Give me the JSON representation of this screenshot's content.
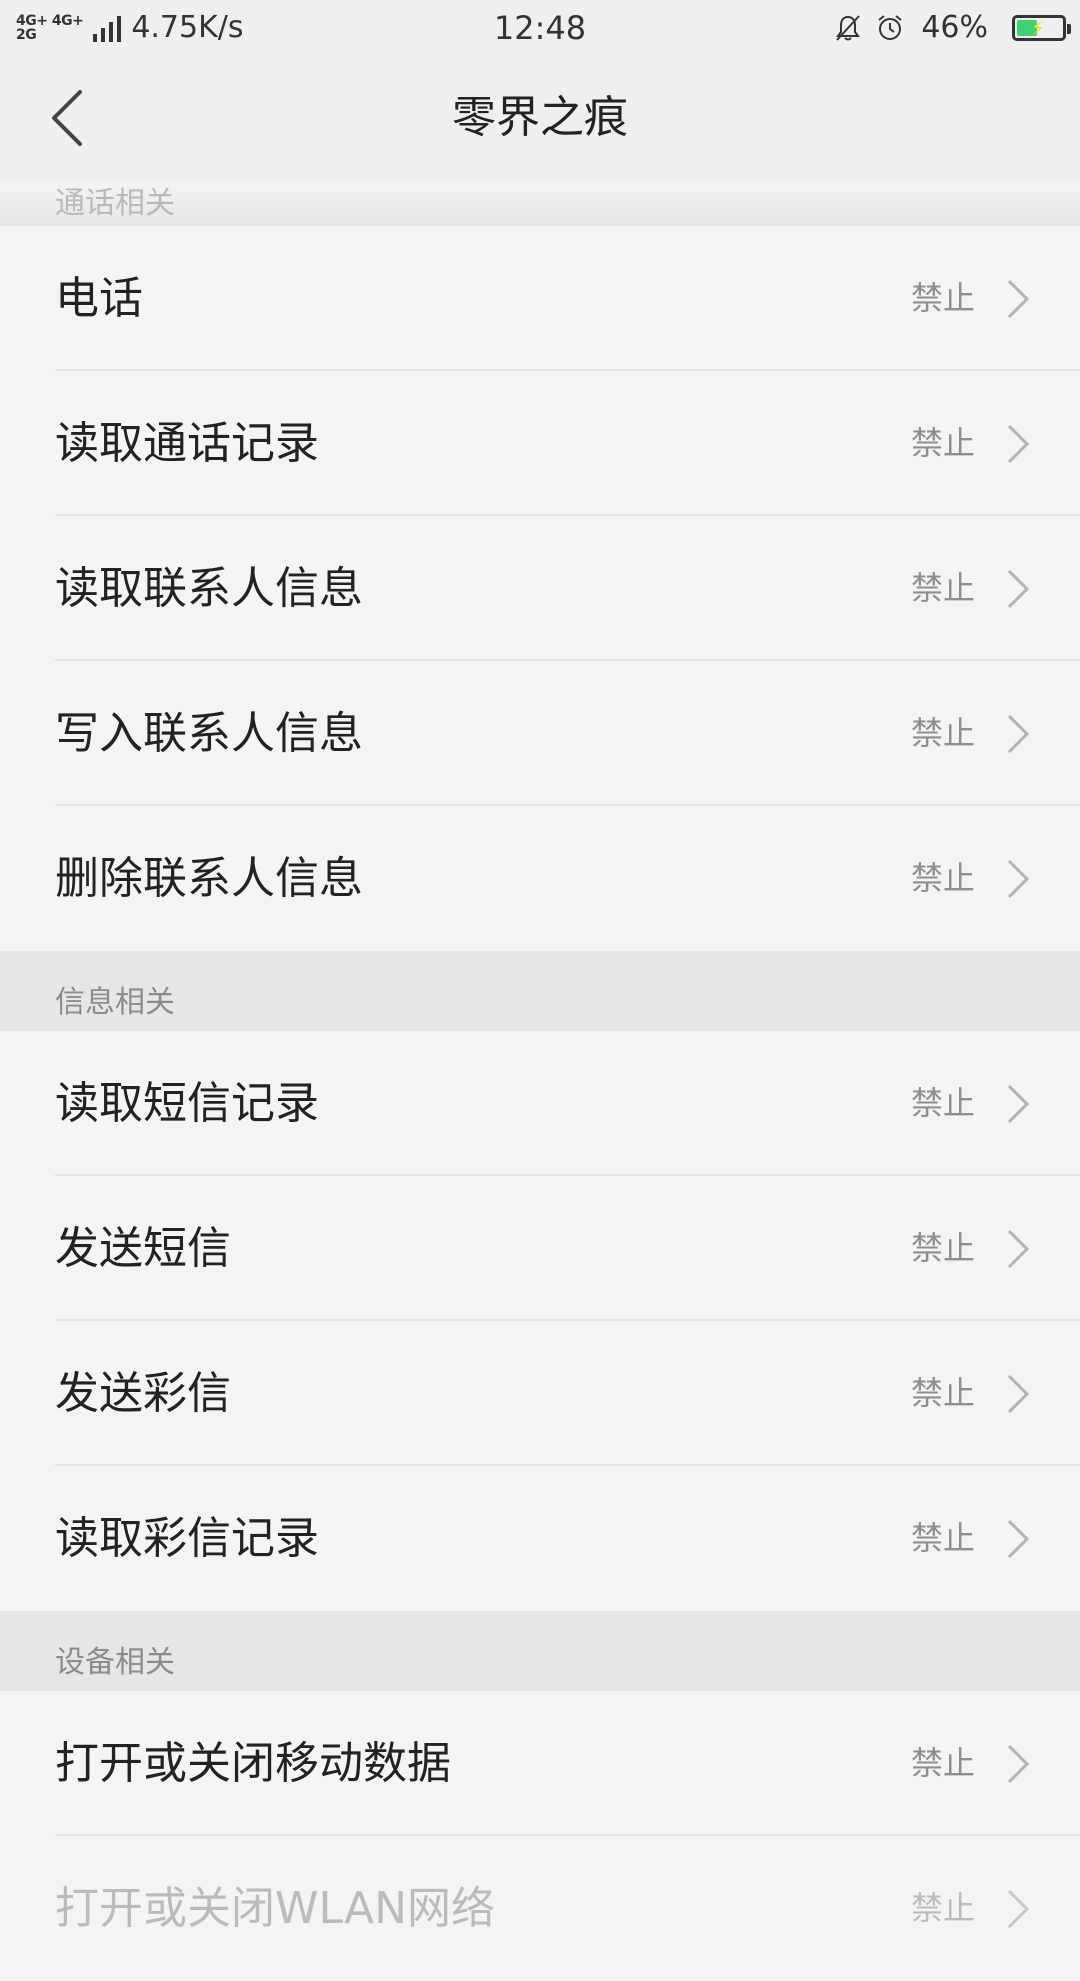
{
  "status_bar": {
    "network_line1": "4G+ 4G+",
    "network_line2": "2G",
    "speed": "4.75K/s",
    "time": "12:48",
    "battery_percent": "46%",
    "battery_level": 0.46,
    "icons": [
      "mute-bell-icon",
      "alarm-clock-icon",
      "battery-charging-icon"
    ],
    "battery_color": "#3fd16e"
  },
  "header": {
    "title": "零界之痕",
    "back_icon": "back-chevron-icon"
  },
  "sections": [
    {
      "title": "通话相关",
      "items": [
        {
          "label": "电话",
          "status": "禁止"
        },
        {
          "label": "读取通话记录",
          "status": "禁止"
        },
        {
          "label": "读取联系人信息",
          "status": "禁止"
        },
        {
          "label": "写入联系人信息",
          "status": "禁止"
        },
        {
          "label": "删除联系人信息",
          "status": "禁止"
        }
      ]
    },
    {
      "title": "信息相关",
      "items": [
        {
          "label": "读取短信记录",
          "status": "禁止"
        },
        {
          "label": "发送短信",
          "status": "禁止"
        },
        {
          "label": "发送彩信",
          "status": "禁止"
        },
        {
          "label": "读取彩信记录",
          "status": "禁止"
        }
      ]
    },
    {
      "title": "设备相关",
      "items": [
        {
          "label": "打开或关闭移动数据",
          "status": "禁止"
        },
        {
          "label": "打开或关闭WLAN网络",
          "status": "禁止"
        }
      ]
    }
  ]
}
